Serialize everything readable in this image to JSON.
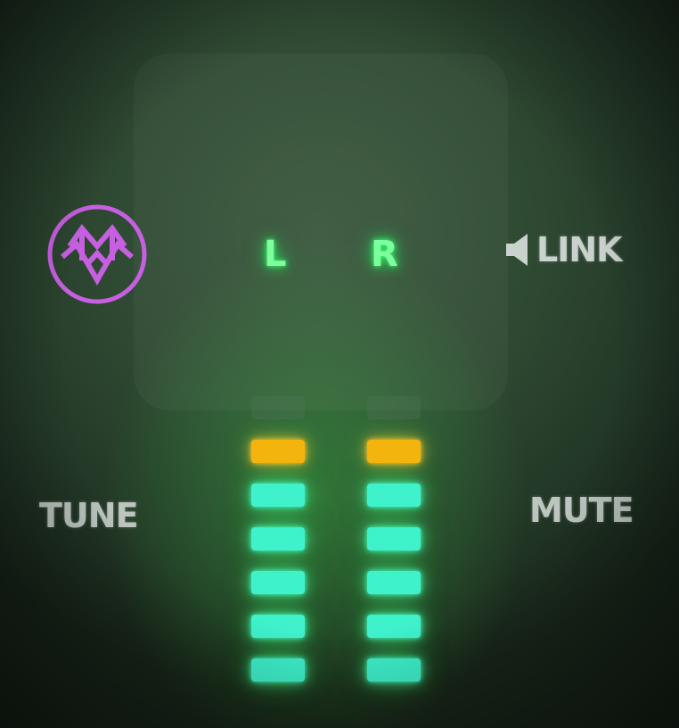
{
  "logo": {
    "icon": "mv-monogram-logo",
    "color": "#c65fe0"
  },
  "channels": {
    "left_label": "L",
    "right_label": "R",
    "label_color": "#7dffa0"
  },
  "controls": {
    "link_label": "LINK",
    "link_icon": "speaker-icon",
    "tune_label": "TUNE",
    "mute_label": "MUTE"
  },
  "meters": {
    "segments_per_channel": 7,
    "left_lit_segments": 6,
    "right_lit_segments": 6,
    "segment_colors": {
      "low": "#3ff2cc",
      "high": "#f4b40e",
      "off": "#4a5e4d"
    }
  }
}
